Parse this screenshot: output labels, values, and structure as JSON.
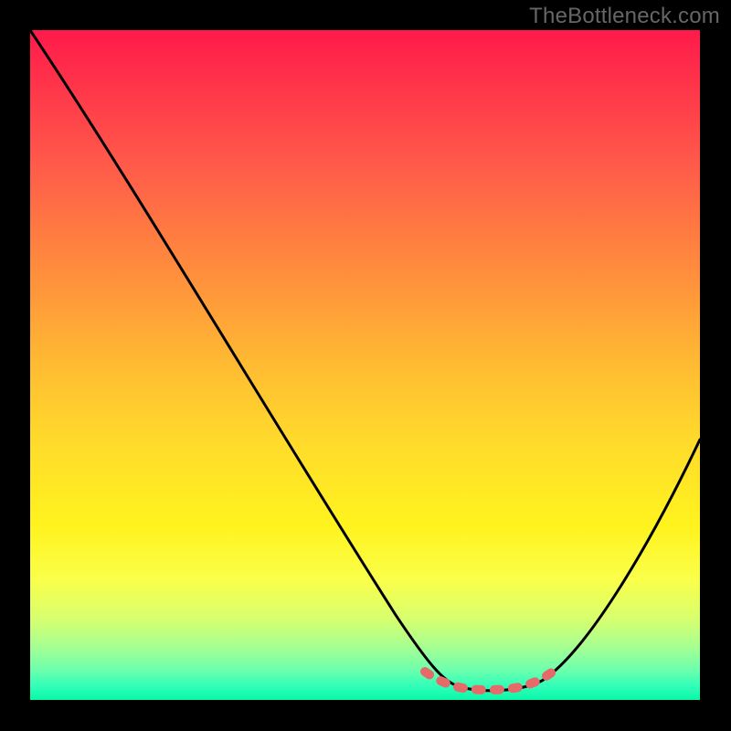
{
  "watermark": "TheBottleneck.com",
  "chart_data": {
    "type": "line",
    "title": "",
    "xlabel": "",
    "ylabel": "",
    "xlim": [
      0,
      100
    ],
    "ylim": [
      0,
      100
    ],
    "series": [
      {
        "name": "bottleneck-curve",
        "x": [
          0,
          6,
          12,
          18,
          24,
          30,
          36,
          42,
          48,
          54,
          58,
          62,
          66,
          70,
          74,
          78,
          84,
          90,
          96,
          100
        ],
        "values": [
          100,
          91,
          82,
          73,
          64,
          55,
          46,
          37,
          28,
          19,
          13,
          7,
          3,
          1,
          1,
          3,
          10,
          20,
          31,
          39
        ]
      },
      {
        "name": "optimal-range-marker",
        "x": [
          60,
          62,
          64,
          66,
          68,
          70,
          72,
          74,
          76,
          78
        ],
        "values": [
          3.5,
          2.5,
          2.0,
          1.8,
          1.7,
          1.7,
          1.8,
          2.0,
          2.5,
          3.5
        ]
      }
    ],
    "annotations": []
  },
  "colors": {
    "curve_stroke": "#000000",
    "marker_stroke": "#e56a6a",
    "background": "#000000"
  }
}
